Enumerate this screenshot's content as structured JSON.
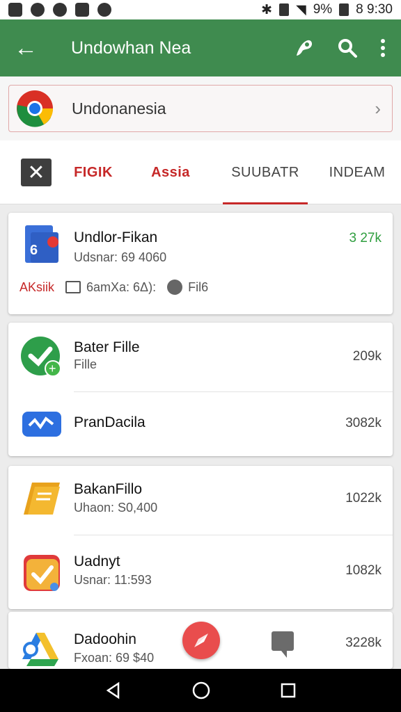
{
  "status_bar": {
    "battery": "9%",
    "time": "8 9:30"
  },
  "app_bar": {
    "title": "Undowhan Nea",
    "back_label": "←"
  },
  "url_bar": {
    "text": "Undonanesia",
    "chevron": "›"
  },
  "tabs": {
    "close_label": "✕",
    "items": [
      "FIGIK",
      "Assia",
      "SUUBATR",
      "INDEAM"
    ]
  },
  "cards": [
    {
      "name": "Undlor-Fikan",
      "sub": "Udsnar: 69 4060",
      "size": "3 27k",
      "meta": {
        "tag": "AKsiik",
        "info": "6amXa: 6Δ):",
        "file": "Fil6"
      }
    },
    {
      "rows": [
        {
          "name": "Bater Fille",
          "sub": "Fille",
          "size": "209k"
        },
        {
          "name": "PranDacila",
          "sub": "",
          "size": "3082k"
        }
      ]
    },
    {
      "rows": [
        {
          "name": "BakanFillo",
          "sub": "Uhaon: S0,400",
          "size": "1022k"
        },
        {
          "name": "Uadnyt",
          "sub": "Usnar: 11:593",
          "size": "1082k"
        }
      ]
    },
    {
      "rows": [
        {
          "name": "Dadoohin",
          "sub": "Fxoan: 69 $40",
          "size": "3228k"
        }
      ]
    }
  ],
  "colors": {
    "appbar": "#3f8b4f",
    "accent_red": "#c62828",
    "size_green": "#2e9e3e"
  }
}
